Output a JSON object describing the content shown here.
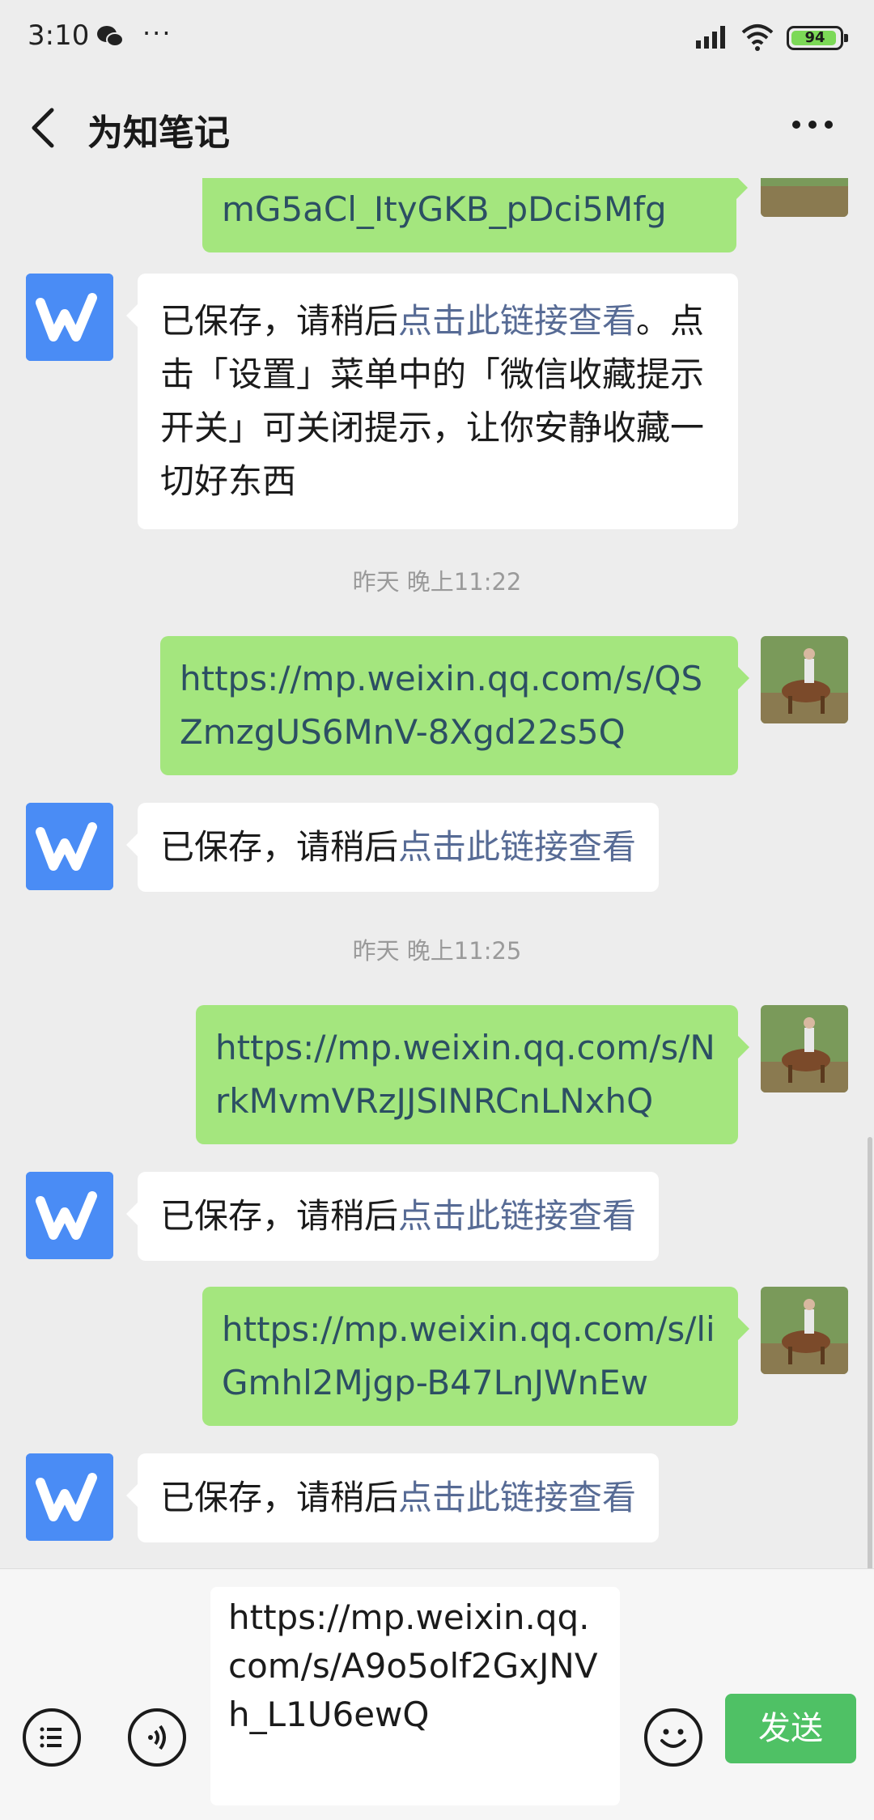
{
  "status_bar": {
    "time": "3:10",
    "more": "···",
    "battery": "94"
  },
  "nav": {
    "title": "为知笔记"
  },
  "messages": {
    "m0_text": "mG5aCl_ItyGKB_pDci5Mfg",
    "m1_pre": "已保存，请稍后",
    "m1_link": "点击此链接查看",
    "m1_post": "。点击「设置」菜单中的「微信收藏提示开关」可关闭提示，让你安静收藏一切好东西",
    "t1": "昨天 晚上11:22",
    "m2_text": "https://mp.weixin.qq.com/s/QSZmzgUS6MnV-8Xgd22s5Q",
    "m3_pre": "已保存，请稍后",
    "m3_link": "点击此链接查看",
    "t2": "昨天 晚上11:25",
    "m4_text": "https://mp.weixin.qq.com/s/NrkMvmVRzJJSINRCnLNxhQ",
    "m5_pre": "已保存，请稍后",
    "m5_link": "点击此链接查看",
    "m6_text": "https://mp.weixin.qq.com/s/liGmhl2Mjgp-B47LnJWnEw",
    "m7_pre": "已保存，请稍后",
    "m7_link": "点击此链接查看"
  },
  "input": {
    "value": "https://mp.weixin.qq.com/s/A9o5olf2GxJNVh_L1U6ewQ",
    "send_label": "发送"
  },
  "colors": {
    "accent_green": "#4fc165",
    "bubble_green": "#a4e67e",
    "link": "#576b95",
    "app_blue": "#4a8cf5"
  }
}
